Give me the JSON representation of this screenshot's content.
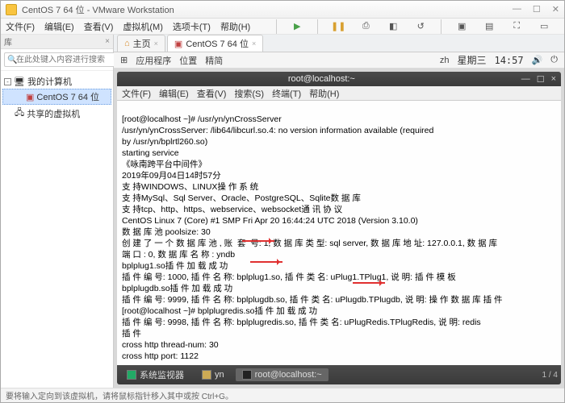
{
  "app": {
    "title": "CentOS 7 64 位 - VMware Workstation",
    "menus": [
      "文件(F)",
      "编辑(E)",
      "查看(V)",
      "虚拟机(M)",
      "选项卡(T)",
      "帮助(H)"
    ]
  },
  "sidebar": {
    "header": "库",
    "search_placeholder": "在此处键入内容进行搜索",
    "nodes": {
      "root": "我的计算机",
      "vm": "CentOS 7 64 位",
      "shared": "共享的虚拟机"
    }
  },
  "tabs": {
    "home": "主页",
    "vm": "CentOS 7 64 位"
  },
  "subbar": {
    "apps": "应用程序",
    "places": "位置",
    "extra": "精简",
    "day": "星期三",
    "time": "14:57"
  },
  "vmwin": {
    "title": "root@localhost:~",
    "menus": [
      "文件(F)",
      "编辑(E)",
      "查看(V)",
      "搜索(S)",
      "终端(T)",
      "帮助(H)"
    ]
  },
  "term": {
    "l0": "[root@localhost ~]# /usr/yn/ynCrossServer",
    "l1": "/usr/yn/ynCrossServer: /lib64/libcurl.so.4: no version information available (required",
    "l2": "by /usr/yn/bplrtl260.so)",
    "l3": "starting service",
    "l4": "《咏南跨平台中间件》",
    "l5": "2019年09月04日14时57分",
    "l6": "支 持WINDOWS、LINUX操 作 系 统",
    "l7": "支 持MySql、Sql Server、Oracle、PostgreSQL、Sqlite数 据 库",
    "l8": "支 持tcp、http、https、webservice、websocket通 讯 协 议",
    "l9": "CentOS Linux 7 (Core) #1 SMP Fri Apr 20 16:44:24 UTC 2018 (Version 3.10.0)",
    "l10": "数 据 库 池 poolsize: 30",
    "l11": "创 建 了 一 个 数 据 库 池 , 账  套  号: 1, 数 据 库 类 型: sql server, 数 据 库 地 址: 127.0.0.1, 数 据 库",
    "l12": "端 口 : 0, 数 据 库 名 称 : yndb",
    "l13": "bplplug1.so插 件 加 载 成 功",
    "l14": "插 件 编 号: 1000, 插 件 名 称: bplplug1.so, 插 件 类 名: uPlug1.TPlug1, 说 明: 插 件 模 板",
    "l15": "bplplugdb.so插 件 加 载 成 功",
    "l16": "插 件 编 号: 9999, 插 件 名 称: bplplugdb.so, 插 件 类 名: uPlugdb.TPlugdb, 说 明: 操 作 数 据 库 插 件",
    "l17": "[root@localhost ~]# bplplugredis.so插 件 加 载 成 功",
    "l18": "插 件 编 号: 9998, 插 件 名 称: bplplugredis.so, 插 件 类 名: uPlugRedis.TPlugRedis, 说 明: redis",
    "l19": "插 件",
    "l20": "cross http thread-num: 30",
    "l21": "cross http port: 1122"
  },
  "taskbar": {
    "t1": "系统监视器",
    "t2": "yn",
    "t3": "root@localhost:~",
    "ws": "1 / 4"
  },
  "status": "要将输入定向到该虚拟机，请将鼠标指针移入其中或按 Ctrl+G。"
}
